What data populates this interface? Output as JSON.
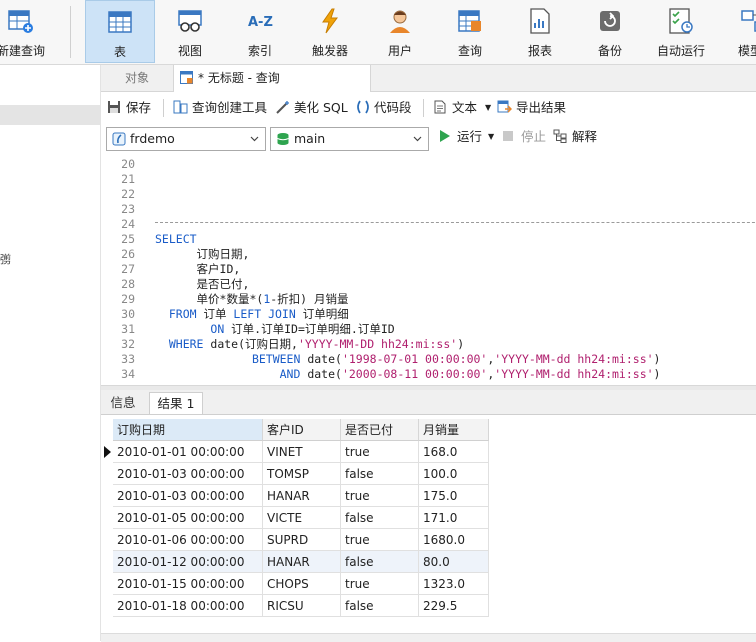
{
  "ribbon": {
    "items": [
      {
        "label": "新建查询",
        "icon": "new-query-icon"
      },
      {
        "label": "表",
        "icon": "table-icon",
        "active": true
      },
      {
        "label": "视图",
        "icon": "view-icon"
      },
      {
        "label": "索引",
        "icon": "index-icon"
      },
      {
        "label": "触发器",
        "icon": "trigger-icon"
      },
      {
        "label": "用户",
        "icon": "user-icon"
      },
      {
        "label": "查询",
        "icon": "query-icon"
      },
      {
        "label": "报表",
        "icon": "report-icon"
      },
      {
        "label": "备份",
        "icon": "backup-icon"
      },
      {
        "label": "自动运行",
        "icon": "automation-icon"
      },
      {
        "label": "模型",
        "icon": "model-icon"
      }
    ]
  },
  "tabs": {
    "objects": "对象",
    "query": "* 无标题 - 查询"
  },
  "query_toolbar": {
    "save": "保存",
    "query_builder": "查询创建工具",
    "beautify": "美化 SQL",
    "snippet": "代码段",
    "text": "文本",
    "export": "导出结果"
  },
  "connection": {
    "database": "frdemo",
    "schema": "main",
    "run": "运行",
    "stop": "停止",
    "explain": "解释"
  },
  "editor": {
    "lines": [
      {
        "no": "20",
        "code": ""
      },
      {
        "no": "21",
        "code": ""
      },
      {
        "no": "22",
        "code": ""
      },
      {
        "no": "23",
        "code": ""
      },
      {
        "no": "24",
        "code": ""
      },
      {
        "no": "25",
        "code": "SELECT"
      },
      {
        "no": "26",
        "code": "      订购日期,"
      },
      {
        "no": "27",
        "code": "      客户ID,"
      },
      {
        "no": "28",
        "code": "      是否已付,"
      },
      {
        "no": "29",
        "code": "      单价*数量*(1-折扣) 月销量"
      },
      {
        "no": "30",
        "code": "  FROM 订单 LEFT JOIN 订单明细"
      },
      {
        "no": "31",
        "code": "        ON 订单.订单ID=订单明细.订单ID"
      },
      {
        "no": "32",
        "code": "  WHERE date(订购日期,'YYYY-MM-DD hh24:mi:ss')"
      },
      {
        "no": "33",
        "code": "              BETWEEN date('1998-07-01 00:00:00','YYYY-MM-dd hh24:mi:ss')"
      },
      {
        "no": "34",
        "code": "                  AND date('2000-08-11 00:00:00','YYYY-MM-dd hh24:mi:ss')"
      }
    ]
  },
  "results": {
    "tab_info": "信息",
    "tab_result": "结果 1",
    "columns": [
      "订购日期",
      "客户ID",
      "是否已付",
      "月销量"
    ],
    "rows": [
      [
        "2010-01-01 00:00:00",
        "VINET",
        "true",
        "168.0"
      ],
      [
        "2010-01-03 00:00:00",
        "TOMSP",
        "false",
        "100.0"
      ],
      [
        "2010-01-03 00:00:00",
        "HANAR",
        "true",
        "175.0"
      ],
      [
        "2010-01-05 00:00:00",
        "VICTE",
        "false",
        "171.0"
      ],
      [
        "2010-01-06 00:00:00",
        "SUPRD",
        "true",
        "1680.0"
      ],
      [
        "2010-01-12 00:00:00",
        "HANAR",
        "false",
        "80.0"
      ],
      [
        "2010-01-15 00:00:00",
        "CHOPS",
        "true",
        "1323.0"
      ],
      [
        "2010-01-18 00:00:00",
        "RICSU",
        "false",
        "229.5"
      ]
    ]
  },
  "colors": {
    "accent": "#cde3f7",
    "keyword": "#1a5cc8",
    "string": "#b0206e"
  }
}
